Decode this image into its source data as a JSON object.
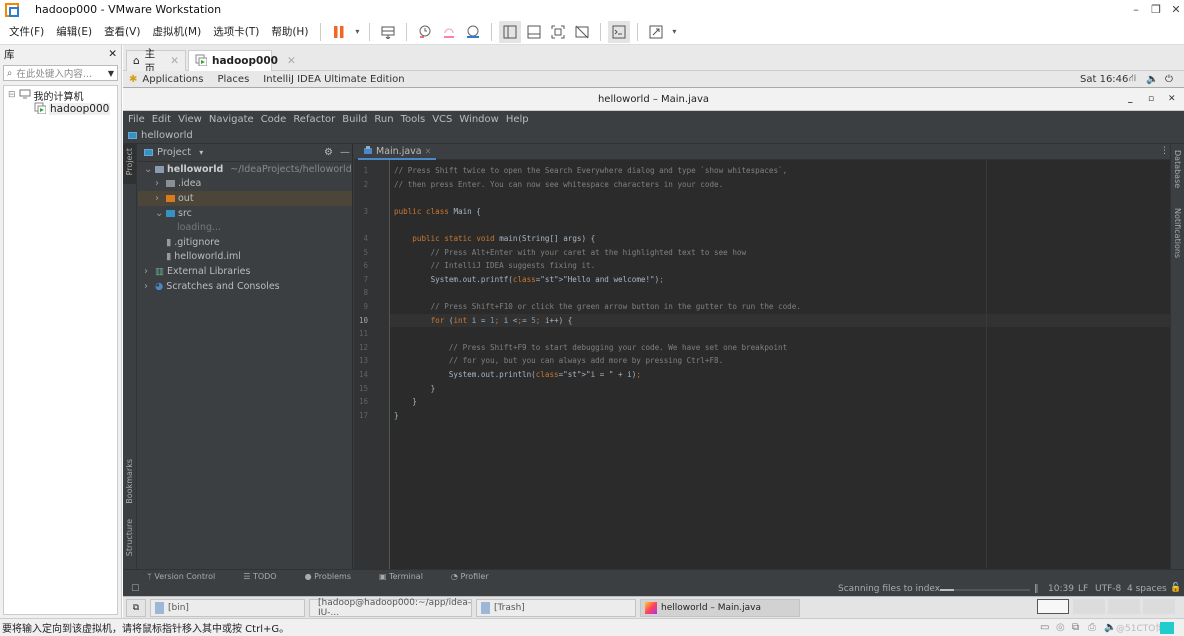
{
  "vmware": {
    "title": "hadoop000 - VMware Workstation",
    "menu": [
      "文件(F)",
      "编辑(E)",
      "查看(V)",
      "虚拟机(M)",
      "选项卡(T)",
      "帮助(H)"
    ],
    "toolbar_icons": [
      "pause-icon",
      "send-ctrl-alt-del-icon",
      "snapshot-icon",
      "revert-snapshot-icon",
      "snapshot-manager-icon",
      "library-view-icon",
      "thumbnail-bar-icon",
      "full-screen-icon",
      "unity-icon",
      "console-view-icon",
      "stretch-icon"
    ],
    "window_controls": {
      "minimize": "–",
      "restore": "❐",
      "close": "✕"
    },
    "library": {
      "title": "库",
      "close": "✕",
      "search_placeholder": "在此处键入内容...",
      "tree": [
        {
          "label": "我的计算机",
          "expander": "⊟"
        },
        {
          "label": "hadoop000"
        }
      ]
    },
    "tabs": [
      {
        "label": "主页",
        "close": "✕"
      },
      {
        "label": "hadoop000",
        "close": "✕",
        "active": true
      }
    ],
    "status_message": "要将输入定向到该虚拟机，请将鼠标指针移入其中或按 Ctrl+G。",
    "watermark": "@51CTO博客"
  },
  "gnome": {
    "menu": [
      "Applications",
      "Places",
      "IntelliJ IDEA Ultimate Edition"
    ],
    "clock": "Sat 16:46"
  },
  "ide": {
    "window_title": "helloworld – Main.java",
    "window_controls": {
      "minimize": "_",
      "maximize": "▫",
      "close": "✕"
    },
    "menu": [
      "File",
      "Edit",
      "View",
      "Navigate",
      "Code",
      "Refactor",
      "Build",
      "Run",
      "Tools",
      "VCS",
      "Window",
      "Help"
    ],
    "breadcrumb": "helloworld",
    "left_strip": [
      "Project",
      "Bookmarks",
      "Structure"
    ],
    "right_strip": [
      "Database",
      "Notifications"
    ],
    "project_panel": {
      "title": "Project",
      "tree": [
        {
          "label": "helloworld",
          "hint": "~/IdeaProjects/helloworld",
          "depth": 0,
          "arrow": "⌄"
        },
        {
          "label": ".idea",
          "depth": 1,
          "arrow": "›"
        },
        {
          "label": "out",
          "depth": 1,
          "arrow": "›",
          "selected": true
        },
        {
          "label": "src",
          "depth": 1,
          "arrow": "⌄"
        },
        {
          "label": "loading...",
          "depth": 3
        },
        {
          "label": ".gitignore",
          "depth": 2
        },
        {
          "label": "helloworld.iml",
          "depth": 2
        },
        {
          "label": "External Libraries",
          "depth": 0,
          "arrow": "›"
        },
        {
          "label": "Scratches and Consoles",
          "depth": 0,
          "arrow": "›"
        }
      ]
    },
    "editor": {
      "tab": "Main.java",
      "current_line": 10,
      "lines": [
        {
          "n": "1",
          "text": "// Press Shift twice to open the Search Everywhere dialog and type `show whitespaces`,"
        },
        {
          "n": "2",
          "text": "// then press Enter. You can now see whitespace characters in your code."
        },
        {
          "n": "3",
          "text": "public class Main {"
        },
        {
          "n": "4",
          "text": "    public static void main(String[] args) {"
        },
        {
          "n": "5",
          "text": "        // Press Alt+Enter with your caret at the highlighted text to see how"
        },
        {
          "n": "6",
          "text": "        // IntelliJ IDEA suggests fixing it."
        },
        {
          "n": "7",
          "text": "        System.out.printf(\"Hello and welcome!\");"
        },
        {
          "n": "8",
          "text": ""
        },
        {
          "n": "9",
          "text": "        // Press Shift+F10 or click the green arrow button in the gutter to run the code."
        },
        {
          "n": "10",
          "text": "        for (int i = 1; i <= 5; i++) {"
        },
        {
          "n": "11",
          "text": ""
        },
        {
          "n": "12",
          "text": "            // Press Shift+F9 to start debugging your code. We have set one breakpoint"
        },
        {
          "n": "13",
          "text": "            // for you, but you can always add more by pressing Ctrl+F8."
        },
        {
          "n": "14",
          "text": "            System.out.println(\"i = \" + i);"
        },
        {
          "n": "15",
          "text": "        }"
        },
        {
          "n": "16",
          "text": "    }"
        },
        {
          "n": "17",
          "text": "}"
        }
      ]
    },
    "tool_windows": [
      "Version Control",
      "TODO",
      "Problems",
      "Terminal",
      "Profiler"
    ],
    "status": {
      "task": "Scanning files to index...",
      "progress": 0.15,
      "position": "10:39",
      "line_sep": "LF",
      "encoding": "UTF-8",
      "indent": "4 spaces"
    }
  },
  "taskbar": {
    "items": [
      {
        "label": "[bin]"
      },
      {
        "label": "[hadoop@hadoop000:~/app/idea-IU-..."
      },
      {
        "label": "[Trash]"
      },
      {
        "label": "helloworld – Main.java",
        "active": true
      }
    ]
  }
}
